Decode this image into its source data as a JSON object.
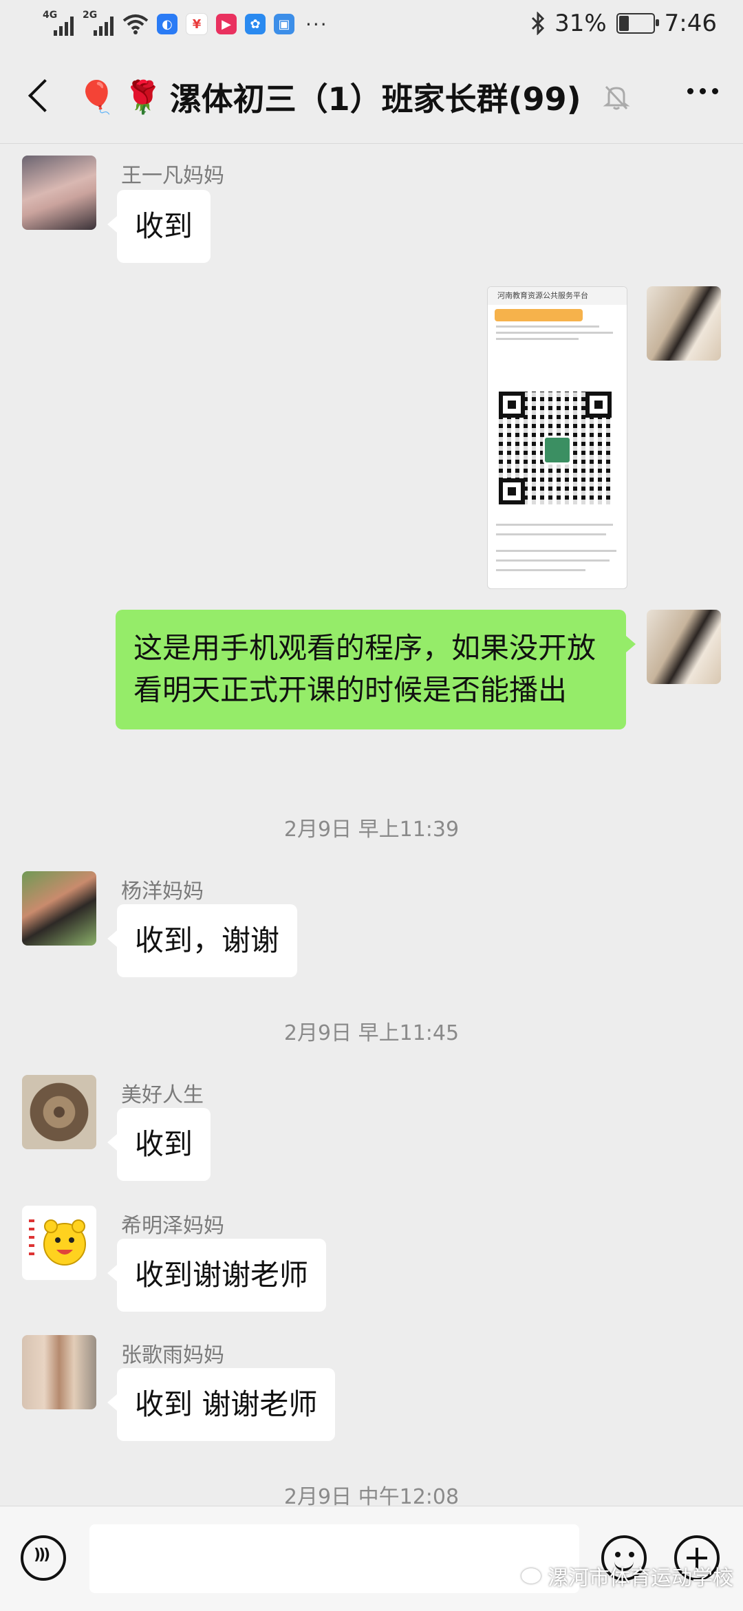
{
  "status_bar": {
    "net1": "4G",
    "net2": "2G",
    "battery_pct": "31%",
    "battery_level": 0.31,
    "time": "7:46",
    "more": "···"
  },
  "chat": {
    "title": "漯体初三（1）班家长群(99)",
    "emoji_balloon": "🎈",
    "emoji_rose": "🌹"
  },
  "messages": {
    "m1": {
      "sender": "王一凡妈妈",
      "text": "收到"
    },
    "m3": {
      "text": "这是用手机观看的程序，如果没开放看明天正式开课的时候是否能播出"
    },
    "ts1": "2月9日 早上11:39",
    "m4": {
      "sender": "杨洋妈妈",
      "text": "收到，谢谢"
    },
    "ts2": "2月9日 早上11:45",
    "m5": {
      "sender": "美好人生",
      "text": "收到"
    },
    "m6": {
      "sender": "希明泽妈妈",
      "text": "收到谢谢老师"
    },
    "m7": {
      "sender": "张歌雨妈妈",
      "text": "收到 谢谢老师"
    },
    "ts3": "2月9日 中午12:08"
  },
  "image_message": {
    "header": "河南教育资源公共服务平台"
  },
  "watermark": "漯河市体育运动学校",
  "colors": {
    "background": "#ededed",
    "self_bubble": "#95ec69",
    "other_bubble": "#ffffff"
  }
}
